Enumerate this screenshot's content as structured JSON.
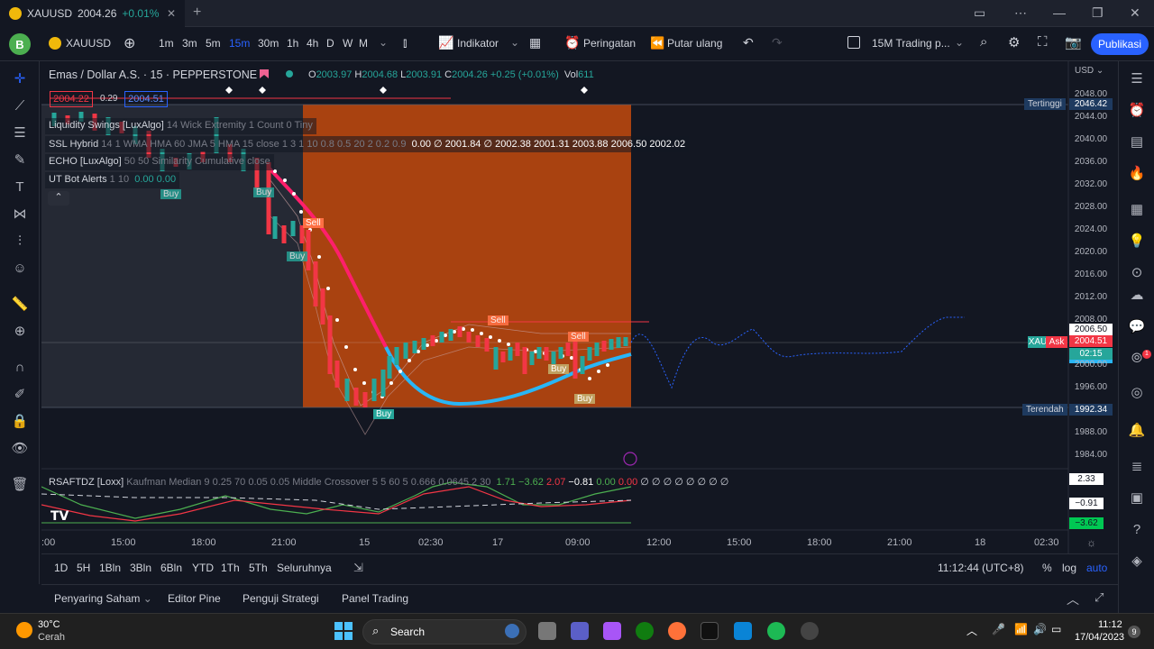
{
  "window": {
    "tab_symbol": "XAUUSD",
    "tab_price": "2004.26",
    "tab_change": "+0.01%",
    "tab_close": "✕",
    "tab_new": "+",
    "controls": [
      "▭",
      "⋯",
      "—",
      "❐",
      "✕"
    ]
  },
  "toolbar": {
    "avatar": "B",
    "symbol": "XAUUSD",
    "add": "⊕",
    "timeframes": [
      "1m",
      "3m",
      "5m",
      "15m",
      "30m",
      "1h",
      "4h",
      "D",
      "W",
      "M"
    ],
    "active_timeframe": "15m",
    "indicators_label": "Indikator",
    "alerts_label": "Peringatan",
    "replay_label": "Putar ulang",
    "layout_label": "15M Trading p...",
    "publish_label": "Publikasi"
  },
  "legend": {
    "title": "Emas / Dollar A.S. · 15 · PEPPERSTONE",
    "o_label": "O",
    "o": "2003.97",
    "h_label": "H",
    "h": "2004.68",
    "l_label": "L",
    "l": "2003.91",
    "c_label": "C",
    "c": "2004.26",
    "change": "+0.25 (+0.01%)",
    "vol_label": "Vol",
    "vol": "611",
    "sell_price": "2004.22",
    "spread": "0.29",
    "buy_price": "2004.51"
  },
  "indicators": [
    {
      "name": "Liquidity Swings [LuxAlgo]",
      "params": "14 Wick Extremity 1 Count 0 Tiny",
      "values": ""
    },
    {
      "name": "SSL Hybrid",
      "params": "14 1 WMA HMA 60 JMA 5 HMA 15 close 1 3 1 10 0.8 0.5 20 2 0.2 0.9",
      "values": "0.00 ∅ 2001.84 ∅ 2002.38 2001.31 2003.88 2006.50 2002.02"
    },
    {
      "name": "ECHO [LuxAlgo]",
      "params": "50 50 Similarity Cumulative close",
      "values": ""
    },
    {
      "name": "UT Bot Alerts",
      "params": "1 10",
      "values": "0.00 0.00"
    }
  ],
  "collapse": "⌃",
  "price_axis": {
    "currency": "USD",
    "ticks": [
      "2048.00",
      "2044.00",
      "2040.00",
      "2036.00",
      "2032.00",
      "2028.00",
      "2024.00",
      "2020.00",
      "2016.00",
      "2012.00",
      "2008.00",
      "2000.00",
      "1996.00",
      "1988.00",
      "1984.00"
    ],
    "high_label": "Tertinggi",
    "high": "2046.42",
    "low_label": "Terendah",
    "low": "1992.34",
    "last_ssl": "2006.50",
    "ask_label": "Ask",
    "ask": "2004.51",
    "countdown": "02:15",
    "symbol_tag": "XAU"
  },
  "chart_signals": {
    "sell": "Sell",
    "buy": "Buy"
  },
  "rsi": {
    "name": "RSAFTDZ [Loxx]",
    "params": "Kaufman Median 9 0.25 70 0.05 0.05 Middle Crossover 5 5 60 5 0.666 0.0645 2 30",
    "v1": "1.71",
    "v2": "−3.62",
    "v3": "2.07",
    "v4": "−0.81",
    "v5": "0.00",
    "v6": "0.00",
    "tail": "∅ ∅ ∅ ∅ ∅ ∅ ∅ ∅",
    "label_top": "2.33",
    "label_mid": "−0.91",
    "label_low": "−3.62",
    "logo": "TV"
  },
  "time_axis": [
    ":00",
    "15:00",
    "18:00",
    "21:00",
    "15",
    "02:30",
    "17",
    "09:00",
    "12:00",
    "15:00",
    "18:00",
    "21:00",
    "18",
    "02:30"
  ],
  "bottom": {
    "ranges": [
      "1D",
      "5H",
      "1Bln",
      "3Bln",
      "6Bln",
      "YTD",
      "1Th",
      "5Th",
      "Seluruhnya"
    ],
    "clock": "11:12:44 (UTC+8)",
    "pct": "%",
    "log": "log",
    "auto": "auto"
  },
  "panels": [
    "Penyaring Saham",
    "Editor Pine",
    "Penguji Strategi",
    "Panel Trading"
  ],
  "taskbar": {
    "temp": "30°C",
    "weather": "Cerah",
    "search": "Search",
    "time": "11:12",
    "date": "17/04/2023",
    "notif": "9"
  },
  "colors": {
    "accent": "#2962ff",
    "bull": "#26a69a",
    "bear": "#f23645",
    "zone": "#b6460f",
    "ssl_pink": "#ff1f6b",
    "ssl_cyan": "#29b6f6"
  }
}
